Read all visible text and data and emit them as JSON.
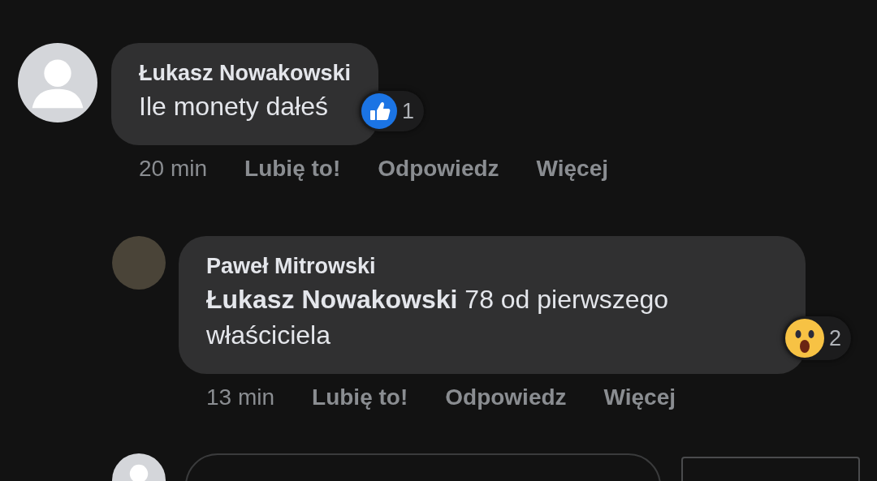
{
  "comments": [
    {
      "avatar": {
        "kind": "default"
      },
      "author": "Łukasz Nowakowski",
      "text": "Ile monety dałeś",
      "reaction": {
        "kind": "like",
        "count": "1"
      },
      "time": "20 min",
      "actions": [
        "Lubię to!",
        "Odpowiedz",
        "Więcej"
      ],
      "reply": false
    },
    {
      "avatar": {
        "kind": "photo"
      },
      "author": "Paweł Mitrowski",
      "text": "**Łukasz Nowakowski** 78 od pierwszego właściciela",
      "reaction": {
        "kind": "wow",
        "count": "2"
      },
      "time": "13 min",
      "actions": [
        "Lubię to!",
        "Odpowiedz",
        "Więcej"
      ],
      "reply": true
    }
  ],
  "composer": {
    "avatar": {
      "kind": "default"
    }
  }
}
